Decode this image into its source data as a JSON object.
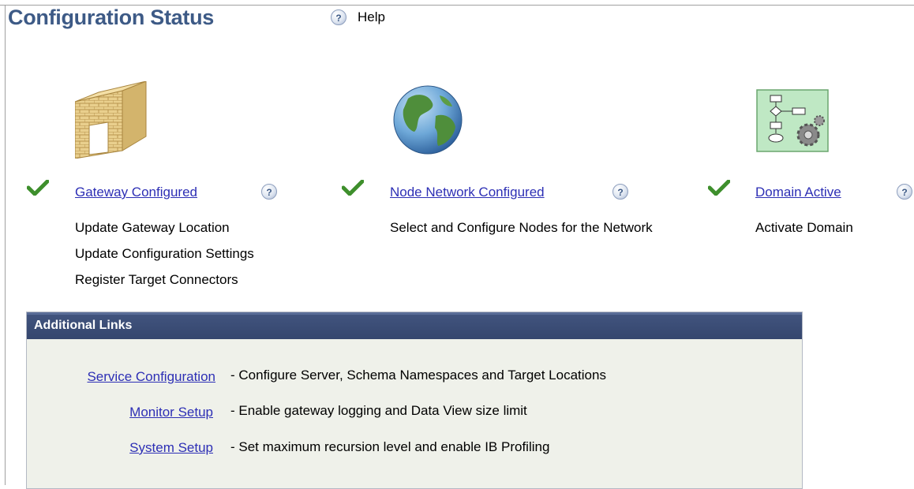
{
  "page": {
    "title": "Configuration Status",
    "help_label": "Help"
  },
  "icons": {
    "help": "help-icon",
    "check": "checkmark-icon"
  },
  "help_glyph": "?",
  "sections": [
    {
      "icon": "brick-wall-icon",
      "status_label": "Gateway Configured",
      "actions": [
        "Update Gateway Location",
        "Update Configuration Settings",
        "Register Target Connectors"
      ]
    },
    {
      "icon": "globe-icon",
      "status_label": "Node Network Configured",
      "actions": [
        "Select and Configure Nodes for the Network"
      ]
    },
    {
      "icon": "flowchart-gear-icon",
      "status_label": "Domain Active",
      "actions": [
        "Activate Domain"
      ]
    }
  ],
  "additional_links": {
    "title": "Additional Links",
    "items": [
      {
        "label": "Service Configuration",
        "description": "- Configure Server, Schema Namespaces and Target Locations"
      },
      {
        "label": "Monitor Setup",
        "description": "- Enable gateway logging and Data View size limit"
      },
      {
        "label": "System Setup",
        "description": "- Set maximum recursion level and enable IB Profiling"
      }
    ]
  },
  "colors": {
    "title": "#3d5a86",
    "link": "#2d2fb5",
    "panel_header": "#3a4b73",
    "panel_bg": "#eff1ea",
    "check": "#3e8f2c"
  }
}
